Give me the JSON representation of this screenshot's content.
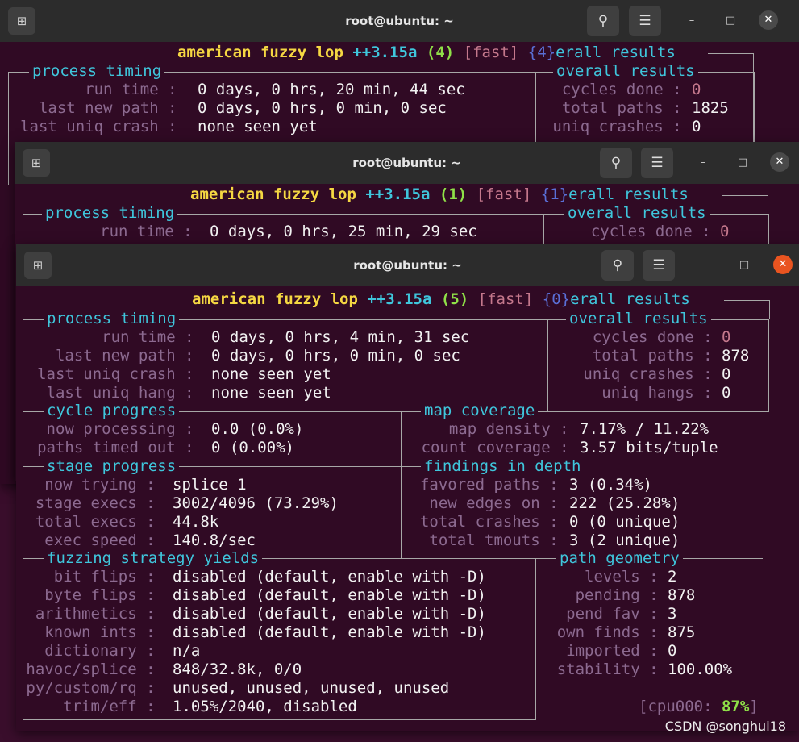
{
  "windows": {
    "back": {
      "title": "root@ubuntu: ~",
      "banner": {
        "name": "american fuzzy lop",
        "version": "++3.15a",
        "instance": "(4)",
        "mode": "[fast]",
        "overlap": "{4}",
        "right": "erall results"
      },
      "process_timing": {
        "title": "process timing",
        "rows": [
          {
            "label": "run time",
            "value": "0 days, 0 hrs, 20 min, 44 sec"
          },
          {
            "label": "last new path",
            "value": "0 days, 0 hrs, 0 min, 0 sec"
          },
          {
            "label": "last uniq crash",
            "value": "none seen yet"
          }
        ]
      },
      "overall_results": {
        "title": "overall results",
        "rows": [
          {
            "label": "cycles done",
            "value": "0"
          },
          {
            "label": "total paths",
            "value": "1825"
          },
          {
            "label": "uniq crashes",
            "value": "0"
          }
        ]
      }
    },
    "middle": {
      "title": "root@ubuntu: ~",
      "banner": {
        "name": "american fuzzy lop",
        "version": "++3.15a",
        "instance": "(1)",
        "mode": "[fast]",
        "overlap": "{1}",
        "right": "erall results"
      },
      "process_timing": {
        "title": "process timing",
        "rows": [
          {
            "label": "run time",
            "value": "0 days, 0 hrs, 25 min, 29 sec"
          }
        ]
      },
      "overall_results": {
        "title": "overall results",
        "rows": [
          {
            "label": "cycles done",
            "value": "0"
          }
        ]
      }
    },
    "front": {
      "title": "root@ubuntu: ~",
      "banner": {
        "name": "american fuzzy lop",
        "version": "++3.15a",
        "instance": "(5)",
        "mode": "[fast]",
        "overlap": "{0}",
        "right": "erall results"
      },
      "process_timing": {
        "title": "process timing",
        "rows": [
          {
            "label": "run time",
            "value": "0 days, 0 hrs, 4 min, 31 sec"
          },
          {
            "label": "last new path",
            "value": "0 days, 0 hrs, 0 min, 0 sec"
          },
          {
            "label": "last uniq crash",
            "value": "none seen yet"
          },
          {
            "label": "last uniq hang",
            "value": "none seen yet"
          }
        ]
      },
      "overall_results": {
        "title": "overall results",
        "rows": [
          {
            "label": "cycles done",
            "value": "0"
          },
          {
            "label": "total paths",
            "value": "878"
          },
          {
            "label": "uniq crashes",
            "value": "0"
          },
          {
            "label": "uniq hangs",
            "value": "0"
          }
        ]
      },
      "cycle_progress": {
        "title": "cycle progress",
        "rows": [
          {
            "label": "now processing",
            "value": "0.0 (0.0%)"
          },
          {
            "label": "paths timed out",
            "value": "0 (0.00%)"
          }
        ]
      },
      "map_coverage": {
        "title": "map coverage",
        "rows": [
          {
            "label": "map density",
            "value": "7.17% / 11.22%"
          },
          {
            "label": "count coverage",
            "value": "3.57 bits/tuple"
          }
        ]
      },
      "stage_progress": {
        "title": "stage progress",
        "rows": [
          {
            "label": "now trying",
            "value": "splice 1"
          },
          {
            "label": "stage execs",
            "value": "3002/4096 (73.29%)"
          },
          {
            "label": "total execs",
            "value": "44.8k"
          },
          {
            "label": "exec speed",
            "value": "140.8/sec"
          }
        ]
      },
      "findings_in_depth": {
        "title": "findings in depth",
        "rows": [
          {
            "label": "favored paths",
            "value": "3 (0.34%)"
          },
          {
            "label": "new edges on",
            "value": "222 (25.28%)"
          },
          {
            "label": "total crashes",
            "value": "0 (0 unique)"
          },
          {
            "label": "total tmouts",
            "value": "3 (2 unique)"
          }
        ]
      },
      "fuzzing_strategy_yields": {
        "title": "fuzzing strategy yields",
        "rows": [
          {
            "label": "bit flips",
            "value": "disabled (default, enable with -D)"
          },
          {
            "label": "byte flips",
            "value": "disabled (default, enable with -D)"
          },
          {
            "label": "arithmetics",
            "value": "disabled (default, enable with -D)"
          },
          {
            "label": "known ints",
            "value": "disabled (default, enable with -D)"
          },
          {
            "label": "dictionary",
            "value": "n/a"
          },
          {
            "label": "havoc/splice",
            "value": "848/32.8k, 0/0"
          },
          {
            "label": "py/custom/rq",
            "value": "unused, unused, unused, unused"
          },
          {
            "label": "trim/eff",
            "value": "1.05%/2040, disabled"
          }
        ]
      },
      "path_geometry": {
        "title": "path geometry",
        "rows": [
          {
            "label": "levels",
            "value": "2"
          },
          {
            "label": "pending",
            "value": "878"
          },
          {
            "label": "pend fav",
            "value": "3"
          },
          {
            "label": "own finds",
            "value": "875"
          },
          {
            "label": "imported",
            "value": "0"
          },
          {
            "label": "stability",
            "value": "100.00%"
          }
        ]
      },
      "cpu": {
        "label": "[cpu000:",
        "value": "87%",
        "close": "]"
      }
    }
  },
  "watermark": "CSDN @songhui18",
  "colors": {
    "terminal_bg": "#300a24",
    "titlebar_bg": "#2c2c2c",
    "label": "#8c6a90",
    "section": "#3fc6dc",
    "banner": "#f5d742",
    "cpu_ok": "#8fe048",
    "close_active": "#e95420"
  }
}
